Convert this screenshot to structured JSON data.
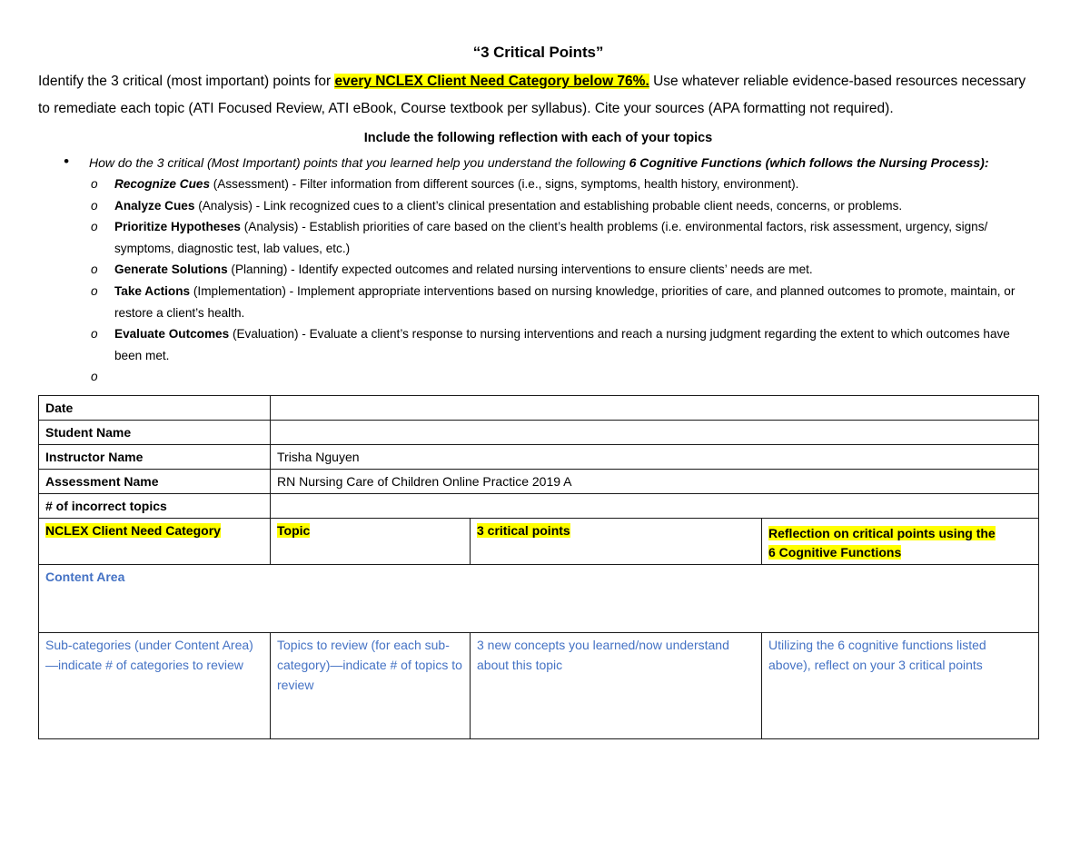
{
  "document": {
    "title": "“3 Critical Points”",
    "intro": {
      "before": "Identify the 3 critical (most important) points for ",
      "highlight": "every NCLEX Client Need Category below 76%.",
      "after": " Use whatever reliable evidence-based resources necessary to remediate each topic (ATI Focused Review, ATI eBook, Course textbook per syllabus). Cite your sources (APA formatting not required)."
    },
    "subheading": "Include the following reflection with each of your topics",
    "prompt": {
      "lead": "How do the 3 critical (Most Important) points that you learned help you understand the following ",
      "emphasis": "6 Cognitive Functions (which follows the Nursing Process):"
    },
    "cognitive_functions": [
      {
        "term": "Recognize Cues",
        "term_italic": true,
        "phase": "(Assessment)",
        "description": " - Filter information from different sources (i.e., signs, symptoms, health history, environment)."
      },
      {
        "term": "Analyze Cues",
        "term_italic": false,
        "phase": "(Analysis)",
        "description": " - Link recognized cues to a client’s clinical presentation and establishing probable client needs, concerns, or problems."
      },
      {
        "term": "Prioritize Hypotheses",
        "term_italic": false,
        "phase": "(Analysis)",
        "description": " - Establish priorities of care based on the client’s health problems (i.e. environmental factors, risk assessment, urgency, signs/ symptoms, diagnostic test, lab values, etc.)"
      },
      {
        "term": "Generate Solutions",
        "term_italic": false,
        "phase": "(Planning)",
        "description": " - Identify expected outcomes and related nursing interventions to ensure clients’ needs are met."
      },
      {
        "term": "Take Actions",
        "term_italic": false,
        "phase": "(Implementation)",
        "description": " - Implement appropriate interventions based on nursing knowledge, priorities of care, and planned outcomes to promote, maintain, or restore a client’s health."
      },
      {
        "term": "Evaluate Outcomes",
        "term_italic": false,
        "phase": "(Evaluation)",
        "description": " - Evaluate a client’s response to nursing interventions and reach a nursing judgment regarding the extent to which outcomes have been met."
      }
    ],
    "bullet_markers": {
      "level1": "•",
      "level2": "o"
    }
  },
  "table": {
    "info_rows": [
      {
        "label": "Date",
        "value": ""
      },
      {
        "label": "Student Name",
        "value": ""
      },
      {
        "label": "Instructor Name",
        "value": "Trisha Nguyen"
      },
      {
        "label": "Assessment Name",
        "value": "RN Nursing Care of Children Online Practice 2019 A"
      },
      {
        "label": "# of incorrect topics",
        "value": ""
      }
    ],
    "column_headers": [
      "NCLEX Client Need Category",
      "Topic",
      "3 critical points",
      "Reflection on critical points using the 6 Cognitive Functions"
    ],
    "column_header_line1": "Reflection on critical points using the",
    "column_header_line2": "6 Cognitive Functions",
    "content_area_label": "Content Area",
    "instruction_cells": [
      "Sub-categories (under Content Area)—indicate # of categories to review",
      "Topics to review (for each sub-category)—indicate # of topics to review",
      "3 new concepts you learned/now understand about this topic",
      "Utilizing the 6 cognitive functions listed above), reflect on your 3 critical points"
    ]
  },
  "colors": {
    "highlight": "#ffff00",
    "blue_text": "#4472c4",
    "border": "#1a1a1a"
  }
}
